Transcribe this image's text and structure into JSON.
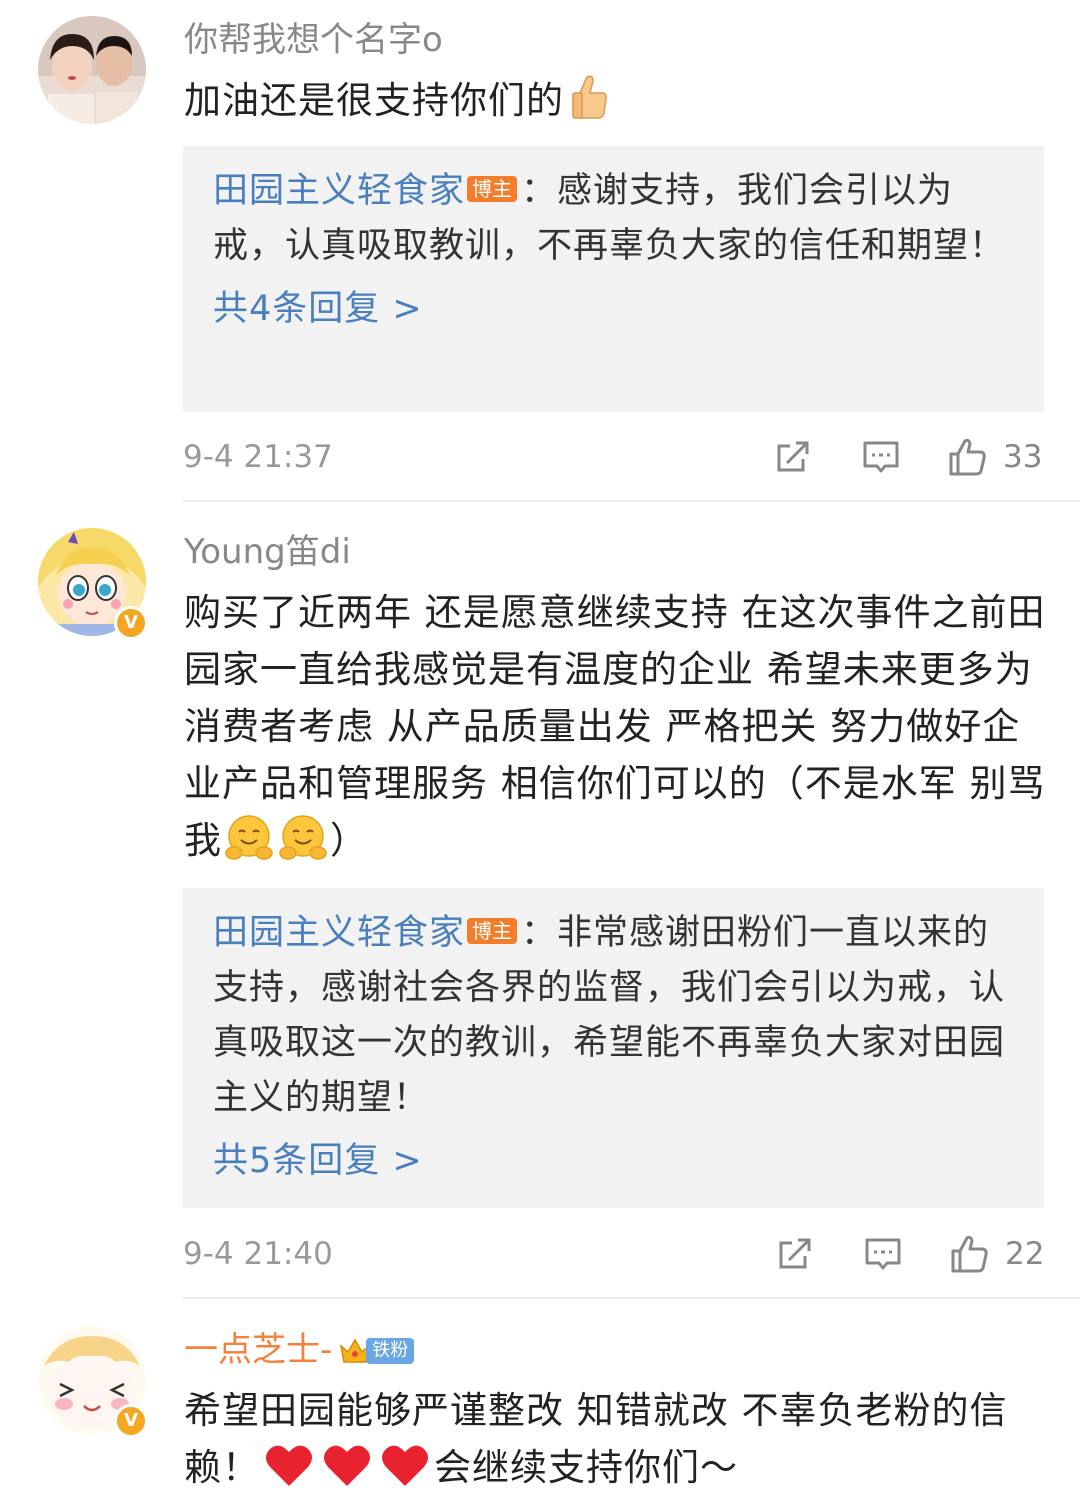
{
  "comments": [
    {
      "username": "你帮我想个名字o",
      "text": "加油还是很支持你们的",
      "text_emoji": "thumbs-up",
      "reply": {
        "author": "田园主义轻食家",
        "badge": "博主",
        "text": "：感谢支持，我们会引以为戒，认真吸取教训，不再辜负大家的信任和期望！"
      },
      "more_replies": "共4条回复 >",
      "timestamp": "9-4 21:37",
      "likes": "33"
    },
    {
      "username": "Young笛di",
      "verified": true,
      "text": "购买了近两年 还是愿意继续支持 在这次事件之前田园家一直给我感觉是有温度的企业 希望未来更多为消费者考虑 从产品质量出发 严格把关 努力做好企业产品和管理服务 相信你们可以的（不是水军 别骂我",
      "text_emoji": "hugging-face x2",
      "text_end": "）",
      "reply": {
        "author": "田园主义轻食家",
        "badge": "博主",
        "text": "：非常感谢田粉们一直以来的支持，感谢社会各界的监督，我们会引以为戒，认真吸取这一次的教训，希望能不再辜负大家对田园主义的期望！"
      },
      "more_replies": "共5条回复 >",
      "timestamp": "9-4 21:40",
      "likes": "22"
    },
    {
      "username": "一点芝士-",
      "verified": true,
      "fan_badge": "铁粉",
      "text": "希望田园能够严谨整改 知错就改 不辜负老粉的信赖！",
      "text_emoji": "red-heart x3",
      "text_end": "会继续支持你们～"
    }
  ],
  "icons": {
    "share": "share-icon",
    "comment": "comment-icon",
    "like": "like-icon"
  },
  "colors": {
    "link_blue": "#4a7fbd",
    "blogger_badge": "#f47d2b",
    "verified_badge": "#f5a623",
    "fan_username": "#f4813a",
    "reply_bg": "#f2f2f2"
  }
}
